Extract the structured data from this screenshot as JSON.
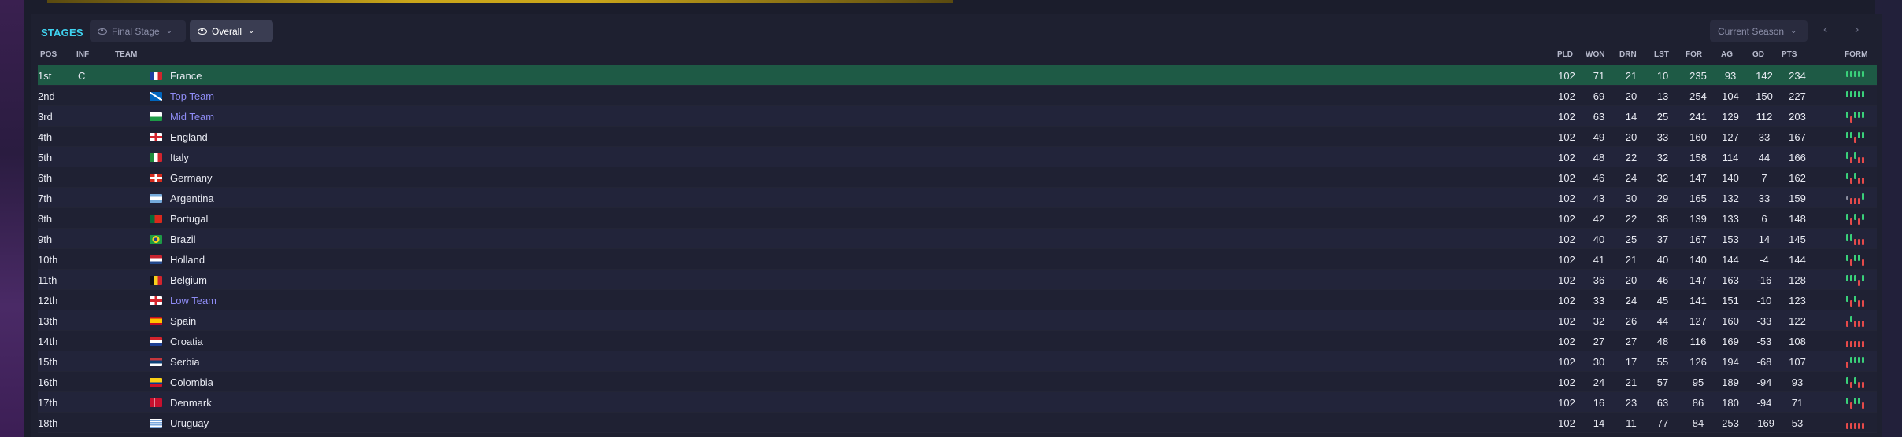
{
  "toolbar": {
    "title": "STAGES",
    "stage_filter": "Final Stage",
    "view_filter": "Overall",
    "season_filter": "Current Season",
    "prev_icon": "chevron-left-icon",
    "next_icon": "chevron-right-icon"
  },
  "columns": {
    "pos": "POS",
    "inf": "INF",
    "team": "TEAM",
    "pld": "PLD",
    "won": "WON",
    "drn": "DRN",
    "lst": "LST",
    "for": "FOR",
    "ag": "AG",
    "gd": "GD",
    "pts": "PTS",
    "form": "FORM"
  },
  "colors": {
    "accent": "#3fd3f0",
    "champion_row": "#1e5a45",
    "user_team_link": "#8f8cf5",
    "form_win": "#3ad07a",
    "form_loss": "#e54a4a"
  },
  "standings": [
    {
      "pos": "1st",
      "inf": "C",
      "team": "France",
      "flag": "france",
      "highlight": false,
      "pld": "102",
      "won": "71",
      "drn": "21",
      "lst": "10",
      "for": "235",
      "ag": "93",
      "gd": "142",
      "pts": "234",
      "form": "WWWWW"
    },
    {
      "pos": "2nd",
      "inf": "",
      "team": "Top Team",
      "flag": "scotland",
      "highlight": true,
      "pld": "102",
      "won": "69",
      "drn": "20",
      "lst": "13",
      "for": "254",
      "ag": "104",
      "gd": "150",
      "pts": "227",
      "form": "WWWWW"
    },
    {
      "pos": "3rd",
      "inf": "",
      "team": "Mid Team",
      "flag": "wales",
      "highlight": true,
      "pld": "102",
      "won": "63",
      "drn": "14",
      "lst": "25",
      "for": "241",
      "ag": "129",
      "gd": "112",
      "pts": "203",
      "form": "WLWWW"
    },
    {
      "pos": "4th",
      "inf": "",
      "team": "England",
      "flag": "england",
      "highlight": false,
      "pld": "102",
      "won": "49",
      "drn": "20",
      "lst": "33",
      "for": "160",
      "ag": "127",
      "gd": "33",
      "pts": "167",
      "form": "WWLWW"
    },
    {
      "pos": "5th",
      "inf": "",
      "team": "Italy",
      "flag": "italy",
      "highlight": false,
      "pld": "102",
      "won": "48",
      "drn": "22",
      "lst": "32",
      "for": "158",
      "ag": "114",
      "gd": "44",
      "pts": "166",
      "form": "WLWLL"
    },
    {
      "pos": "6th",
      "inf": "",
      "team": "Germany",
      "flag": "switzerland",
      "highlight": false,
      "pld": "102",
      "won": "46",
      "drn": "24",
      "lst": "32",
      "for": "147",
      "ag": "140",
      "gd": "7",
      "pts": "162",
      "form": "WLWLL"
    },
    {
      "pos": "7th",
      "inf": "",
      "team": "Argentina",
      "flag": "argentina",
      "highlight": false,
      "pld": "102",
      "won": "43",
      "drn": "30",
      "lst": "29",
      "for": "165",
      "ag": "132",
      "gd": "33",
      "pts": "159",
      "form": "DLLLW"
    },
    {
      "pos": "8th",
      "inf": "",
      "team": "Portugal",
      "flag": "portugal",
      "highlight": false,
      "pld": "102",
      "won": "42",
      "drn": "22",
      "lst": "38",
      "for": "139",
      "ag": "133",
      "gd": "6",
      "pts": "148",
      "form": "WLWLW"
    },
    {
      "pos": "9th",
      "inf": "",
      "team": "Brazil",
      "flag": "brazil",
      "highlight": false,
      "pld": "102",
      "won": "40",
      "drn": "25",
      "lst": "37",
      "for": "167",
      "ag": "153",
      "gd": "14",
      "pts": "145",
      "form": "WWLLL"
    },
    {
      "pos": "10th",
      "inf": "",
      "team": "Holland",
      "flag": "netherlands",
      "highlight": false,
      "pld": "102",
      "won": "41",
      "drn": "21",
      "lst": "40",
      "for": "140",
      "ag": "144",
      "gd": "-4",
      "pts": "144",
      "form": "WLWWL"
    },
    {
      "pos": "11th",
      "inf": "",
      "team": "Belgium",
      "flag": "belgium",
      "highlight": false,
      "pld": "102",
      "won": "36",
      "drn": "20",
      "lst": "46",
      "for": "147",
      "ag": "163",
      "gd": "-16",
      "pts": "128",
      "form": "WWWLW"
    },
    {
      "pos": "12th",
      "inf": "",
      "team": "Low Team",
      "flag": "england",
      "highlight": true,
      "pld": "102",
      "won": "33",
      "drn": "24",
      "lst": "45",
      "for": "141",
      "ag": "151",
      "gd": "-10",
      "pts": "123",
      "form": "WLWLL"
    },
    {
      "pos": "13th",
      "inf": "",
      "team": "Spain",
      "flag": "spain",
      "highlight": false,
      "pld": "102",
      "won": "32",
      "drn": "26",
      "lst": "44",
      "for": "127",
      "ag": "160",
      "gd": "-33",
      "pts": "122",
      "form": "LWLLL"
    },
    {
      "pos": "14th",
      "inf": "",
      "team": "Croatia",
      "flag": "croatia",
      "highlight": false,
      "pld": "102",
      "won": "27",
      "drn": "27",
      "lst": "48",
      "for": "116",
      "ag": "169",
      "gd": "-53",
      "pts": "108",
      "form": "LLLLL"
    },
    {
      "pos": "15th",
      "inf": "",
      "team": "Serbia",
      "flag": "serbia",
      "highlight": false,
      "pld": "102",
      "won": "30",
      "drn": "17",
      "lst": "55",
      "for": "126",
      "ag": "194",
      "gd": "-68",
      "pts": "107",
      "form": "LWWWW"
    },
    {
      "pos": "16th",
      "inf": "",
      "team": "Colombia",
      "flag": "colombia",
      "highlight": false,
      "pld": "102",
      "won": "24",
      "drn": "21",
      "lst": "57",
      "for": "95",
      "ag": "189",
      "gd": "-94",
      "pts": "93",
      "form": "WLWLL"
    },
    {
      "pos": "17th",
      "inf": "",
      "team": "Denmark",
      "flag": "denmark",
      "highlight": false,
      "pld": "102",
      "won": "16",
      "drn": "23",
      "lst": "63",
      "for": "86",
      "ag": "180",
      "gd": "-94",
      "pts": "71",
      "form": "WLWWL"
    },
    {
      "pos": "18th",
      "inf": "",
      "team": "Uruguay",
      "flag": "uruguay",
      "highlight": false,
      "pld": "102",
      "won": "14",
      "drn": "11",
      "lst": "77",
      "for": "84",
      "ag": "253",
      "gd": "-169",
      "pts": "53",
      "form": "LLLLL"
    }
  ]
}
